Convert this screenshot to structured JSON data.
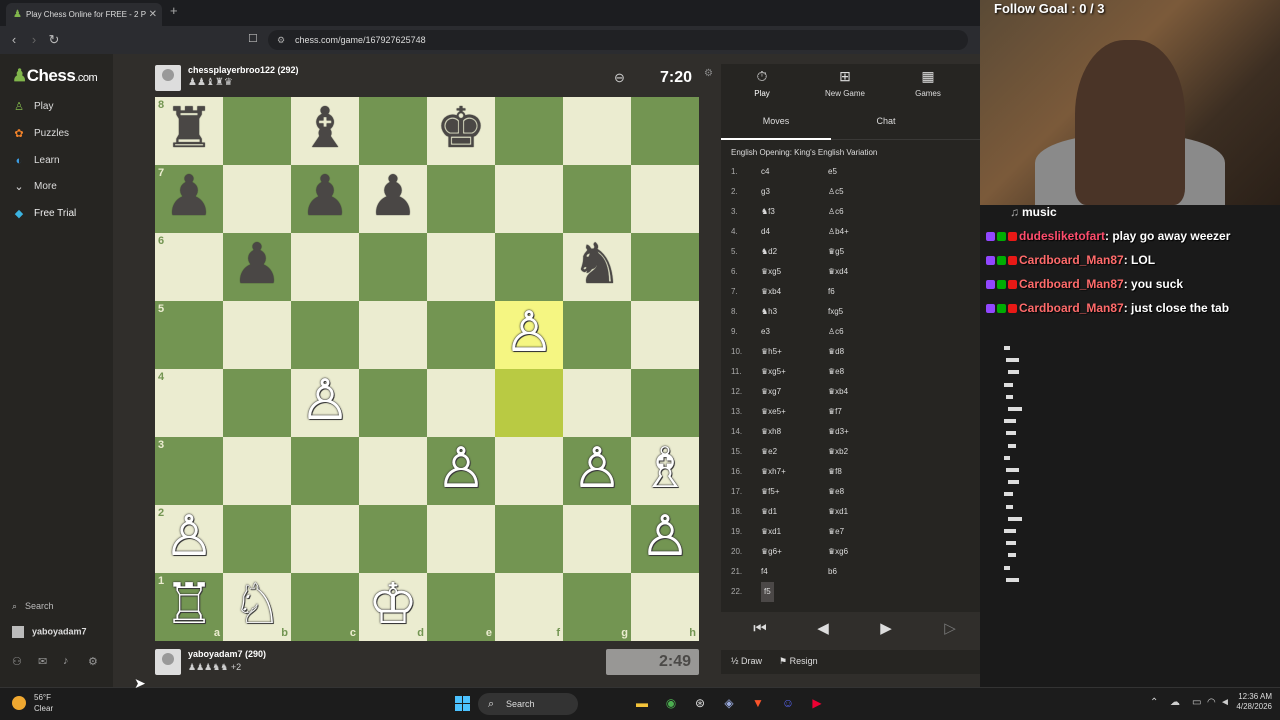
{
  "browser": {
    "tab_title": "Play Chess Online for FREE - 2 P",
    "url": "chess.com/game/167927625748"
  },
  "sidebar": {
    "logo_text": "Chess",
    "logo_domain": ".com",
    "items": [
      {
        "label": "Play",
        "icon": "play-icon"
      },
      {
        "label": "Puzzles",
        "icon": "puzzle-icon"
      },
      {
        "label": "Learn",
        "icon": "learn-icon"
      },
      {
        "label": "More",
        "icon": "chevron-down-icon"
      },
      {
        "label": "Free Trial",
        "icon": "diamond-icon"
      }
    ],
    "search_label": "Search",
    "user_label": "yaboyadam7"
  },
  "players": {
    "top": {
      "name": "chessplayerbroo122 (292)",
      "captured": "♟♟♝♜♛",
      "clock": "7:20"
    },
    "bottom": {
      "name": "yaboyadam7 (290)",
      "captured": "♟♟♟♞♞ +2",
      "clock": "2:49"
    }
  },
  "board": {
    "ranks": [
      "8",
      "7",
      "6",
      "5",
      "4",
      "3",
      "2",
      "1"
    ],
    "files": [
      "a",
      "b",
      "c",
      "d",
      "e",
      "f",
      "g",
      "h"
    ],
    "highlight": [
      "f5",
      "f4"
    ],
    "pieces": [
      {
        "sq": "a8",
        "p": "♜",
        "c": "b"
      },
      {
        "sq": "c8",
        "p": "♝",
        "c": "b"
      },
      {
        "sq": "e8",
        "p": "♚",
        "c": "b"
      },
      {
        "sq": "a7",
        "p": "♟",
        "c": "b"
      },
      {
        "sq": "c7",
        "p": "♟",
        "c": "b"
      },
      {
        "sq": "d7",
        "p": "♟",
        "c": "b"
      },
      {
        "sq": "b6",
        "p": "♟",
        "c": "b"
      },
      {
        "sq": "g6",
        "p": "♞",
        "c": "b"
      },
      {
        "sq": "f5",
        "p": "♙",
        "c": "w"
      },
      {
        "sq": "c4",
        "p": "♙",
        "c": "w"
      },
      {
        "sq": "e3",
        "p": "♙",
        "c": "w"
      },
      {
        "sq": "g3",
        "p": "♙",
        "c": "w"
      },
      {
        "sq": "h3",
        "p": "♗",
        "c": "w"
      },
      {
        "sq": "a2",
        "p": "♙",
        "c": "w"
      },
      {
        "sq": "h2",
        "p": "♙",
        "c": "w"
      },
      {
        "sq": "a1",
        "p": "♖",
        "c": "w"
      },
      {
        "sq": "b1",
        "p": "♘",
        "c": "w"
      },
      {
        "sq": "d1",
        "p": "♔",
        "c": "w"
      }
    ]
  },
  "panel": {
    "tabs": [
      {
        "label": "Play",
        "icon": "stopwatch-icon"
      },
      {
        "label": "New Game",
        "icon": "plus-icon"
      },
      {
        "label": "Games",
        "icon": "grid-icon"
      }
    ],
    "subtabs": [
      "Moves",
      "Chat"
    ],
    "opening": "English Opening: King's English Variation",
    "moves": [
      [
        "1.",
        "c4",
        "e5"
      ],
      [
        "2.",
        "g3",
        "♙c5"
      ],
      [
        "3.",
        "♞f3",
        "♙c6"
      ],
      [
        "4.",
        "d4",
        "♙b4+"
      ],
      [
        "5.",
        "♞d2",
        "♛g5"
      ],
      [
        "6.",
        "♛xg5",
        "♛xd4"
      ],
      [
        "7.",
        "♛xb4",
        "f6"
      ],
      [
        "8.",
        "♞h3",
        "fxg5"
      ],
      [
        "9.",
        "e3",
        "♙c6"
      ],
      [
        "10.",
        "♛h5+",
        "♛d8"
      ],
      [
        "11.",
        "♛xg5+",
        "♛e8"
      ],
      [
        "12.",
        "♛xg7",
        "♛xb4"
      ],
      [
        "13.",
        "♛xe5+",
        "♛f7"
      ],
      [
        "14.",
        "♛xh8",
        "♛d3+"
      ],
      [
        "15.",
        "♛e2",
        "♛xb2"
      ],
      [
        "16.",
        "♛xh7+",
        "♛f8"
      ],
      [
        "17.",
        "♛f5+",
        "♛e8"
      ],
      [
        "18.",
        "♛d1",
        "♛xd1"
      ],
      [
        "19.",
        "♛xd1",
        "♛e7"
      ],
      [
        "20.",
        "♛g6+",
        "♛xg6"
      ],
      [
        "21.",
        "f4",
        "b6"
      ],
      [
        "22.",
        "f5",
        ""
      ]
    ],
    "controls": [
      "first-move-icon",
      "prev-move-icon",
      "play-icon",
      "next-move-icon",
      "last-move-icon"
    ],
    "draw_label": "Draw",
    "resign_label": "Resign"
  },
  "stream": {
    "follow_goal": "Follow Goal : 0 / 3",
    "music_label": "music",
    "chat": [
      {
        "user": "dudesliketofart",
        "msg": ": play go away weezer"
      },
      {
        "user": "Cardboard_Man87",
        "msg": ": LOL"
      },
      {
        "user": "Cardboard_Man87",
        "msg": ": you suck"
      },
      {
        "user": "Cardboard_Man87",
        "msg": ": just close the tab"
      }
    ]
  },
  "taskbar": {
    "weather_temp": "56°F",
    "weather_desc": "Clear",
    "search_label": "Search",
    "time": "12:36 AM",
    "date": "4/28/2026"
  },
  "colors": {
    "light_square": "#ebecd0",
    "dark_square": "#739552",
    "highlight": "#f5f682",
    "accent": "#81b64c"
  }
}
